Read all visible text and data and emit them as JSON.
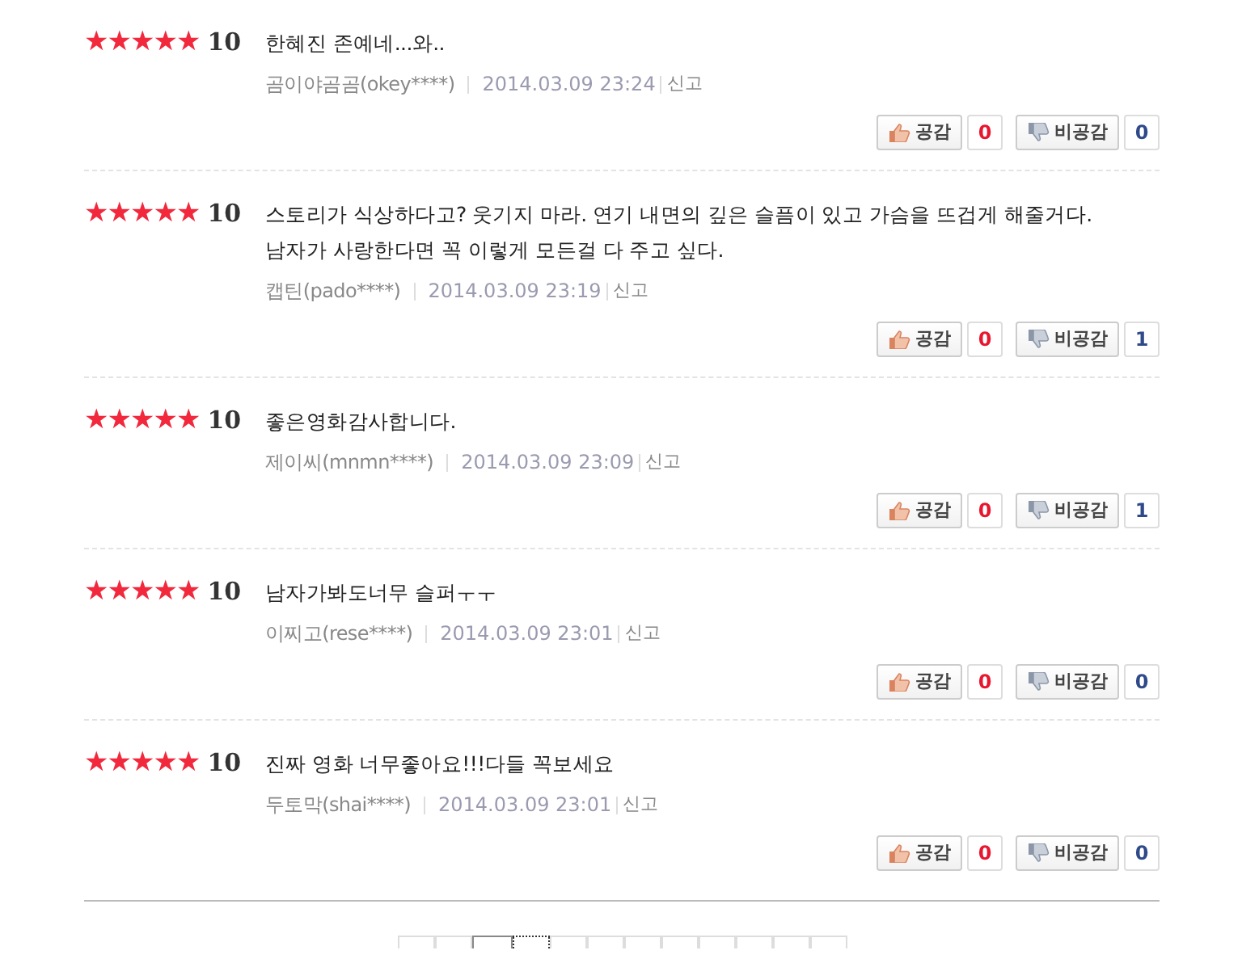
{
  "reviews": [
    {
      "stars": 5,
      "score": "10",
      "text": [
        "한혜진 존예네...와.."
      ],
      "author": "곰이야곰곰(okey****)",
      "date": "2014.03.09 23:24",
      "report": "신고",
      "like_label": "공감",
      "like_count": "0",
      "dislike_label": "비공감",
      "dislike_count": "0"
    },
    {
      "stars": 5,
      "score": "10",
      "text": [
        "스토리가 식상하다고? 웃기지 마라. 연기 내면의 깊은 슬픔이 있고 가슴을 뜨겁게 해줄거다.",
        "남자가 사랑한다면 꼭 이렇게 모든걸 다 주고 싶다."
      ],
      "author": "캡틴(pado****)",
      "date": "2014.03.09 23:19",
      "report": "신고",
      "like_label": "공감",
      "like_count": "0",
      "dislike_label": "비공감",
      "dislike_count": "1"
    },
    {
      "stars": 5,
      "score": "10",
      "text": [
        "좋은영화감사합니다."
      ],
      "author": "제이씨(mnmn****)",
      "date": "2014.03.09 23:09",
      "report": "신고",
      "like_label": "공감",
      "like_count": "0",
      "dislike_label": "비공감",
      "dislike_count": "1"
    },
    {
      "stars": 5,
      "score": "10",
      "text": [
        "남자가봐도너무 슬퍼ㅜㅜ"
      ],
      "author": "이찌고(rese****)",
      "date": "2014.03.09 23:01",
      "report": "신고",
      "like_label": "공감",
      "like_count": "0",
      "dislike_label": "비공감",
      "dislike_count": "0"
    },
    {
      "stars": 5,
      "score": "10",
      "text": [
        "진짜 영화 너무좋아요!!!다들 꼭보세요"
      ],
      "author": "두토막(shai****)",
      "date": "2014.03.09 23:01",
      "report": "신고",
      "like_label": "공감",
      "like_count": "0",
      "dislike_label": "비공감",
      "dislike_count": "0"
    }
  ],
  "pagination": [
    {
      "selected": false,
      "focused": false
    },
    {
      "selected": false,
      "focused": false
    },
    {
      "selected": true,
      "focused": false
    },
    {
      "selected": false,
      "focused": true
    },
    {
      "selected": false,
      "focused": false
    },
    {
      "selected": false,
      "focused": false
    },
    {
      "selected": false,
      "focused": false
    },
    {
      "selected": false,
      "focused": false
    },
    {
      "selected": false,
      "focused": false
    },
    {
      "selected": false,
      "focused": false
    },
    {
      "selected": false,
      "focused": false
    },
    {
      "selected": false,
      "focused": false
    }
  ]
}
